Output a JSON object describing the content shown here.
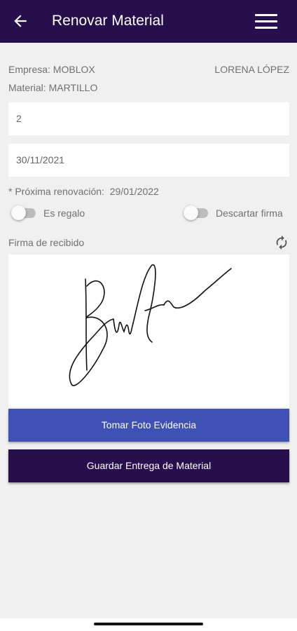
{
  "header": {
    "title": "Renovar Material",
    "back_icon": "arrow-left-icon",
    "menu_icon": "hamburger-menu-icon",
    "background_color": "#270f4d"
  },
  "info": {
    "empresa": "Empresa: MOBLOX",
    "user": "LORENA LÓPEZ",
    "material": "Material: MARTILLO"
  },
  "form": {
    "quantity_value": "2",
    "date_value": "30/11/2021",
    "next_renewal": "* Próxima renovación:  29/01/2022",
    "gift_toggle": {
      "label": "Es regalo",
      "on": false
    },
    "discard_toggle": {
      "label": "Descartar firma",
      "on": false
    },
    "signature_label": "Firma de recibido",
    "refresh_icon": "refresh-icon"
  },
  "buttons": {
    "photo_label": "Tomar Foto Evidencia",
    "save_label": "Guardar Entrega de Material",
    "photo_color": "#3f51b5",
    "save_color": "#270f4d"
  }
}
